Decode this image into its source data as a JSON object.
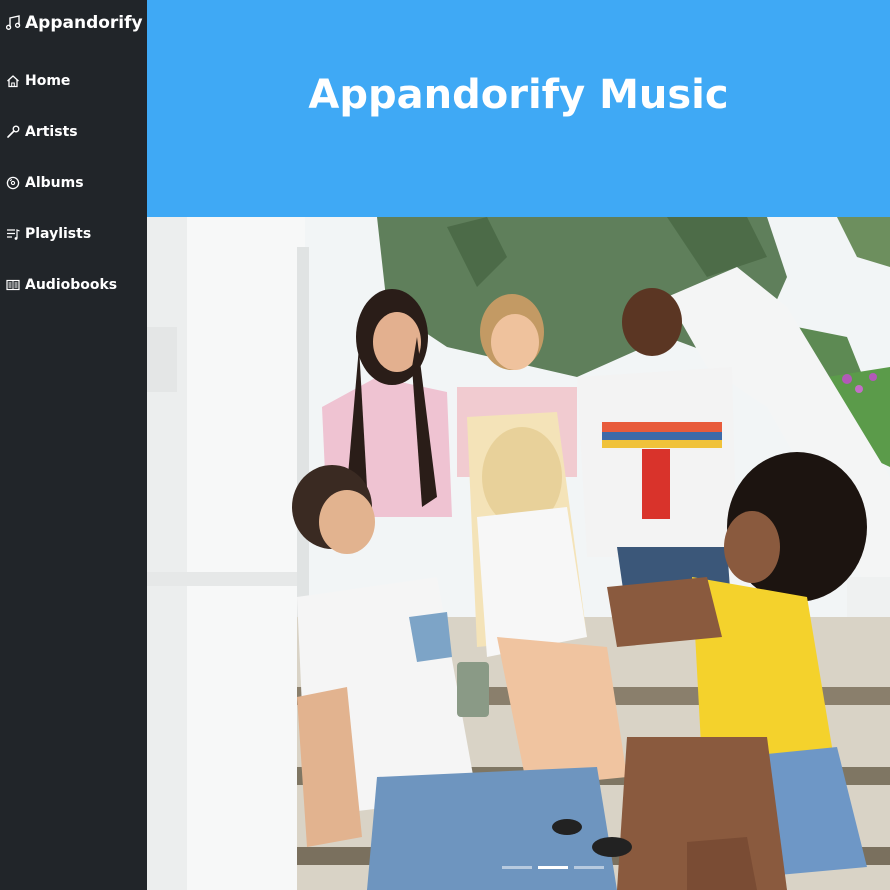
{
  "app": {
    "title": "Appandorify",
    "header_title": "Appandorify Music"
  },
  "sidebar": {
    "items": [
      {
        "label": "Home",
        "icon": "home-icon"
      },
      {
        "label": "Artists",
        "icon": "microphone-icon"
      },
      {
        "label": "Albums",
        "icon": "disc-icon"
      },
      {
        "label": "Playlists",
        "icon": "playlist-icon"
      },
      {
        "label": "Audiobooks",
        "icon": "book-icon"
      }
    ]
  },
  "hero": {
    "carousel_active_index": 1,
    "carousel_count": 3
  },
  "colors": {
    "sidebar_bg": "#212529",
    "banner_bg": "#3fa9f5",
    "text": "#ffffff"
  }
}
